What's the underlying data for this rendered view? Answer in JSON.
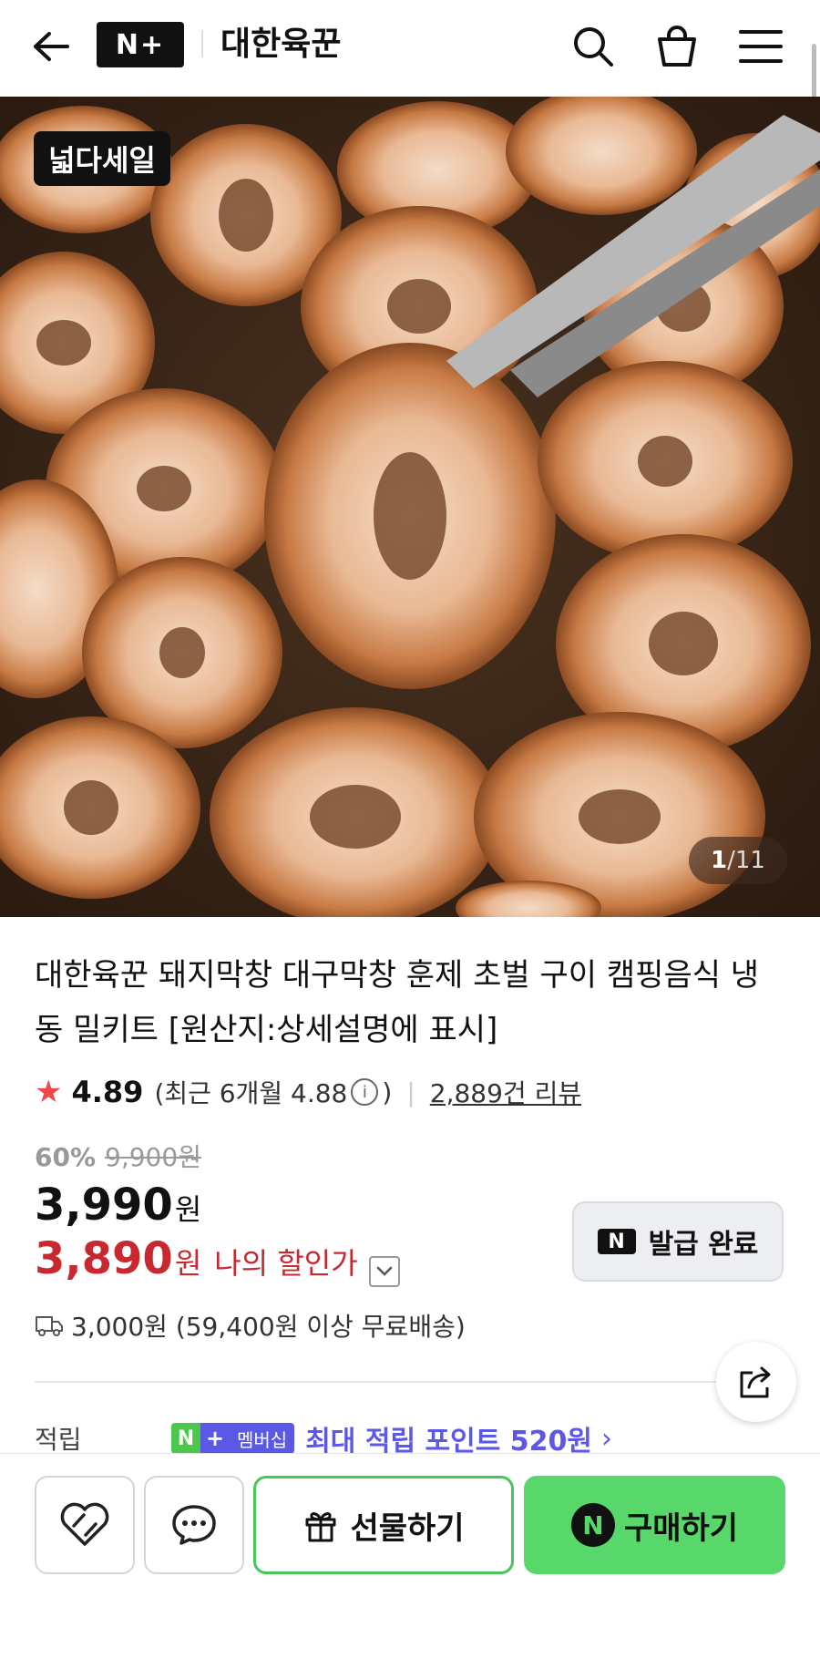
{
  "header": {
    "logo_text": "N+",
    "store_name": "대한육꾼"
  },
  "hero": {
    "sale_badge": "넓다세일",
    "counter_current": "1",
    "counter_total": "/11"
  },
  "product": {
    "title": "대한육꾼 돼지막창 대구막창 훈제 초벌 구이 캠핑음식 냉동 밀키트 [원산지:상세설명에 표시]",
    "rating": "4.89",
    "recent_rating": "(최근 6개월 4.88",
    "recent_close": ")",
    "info_icon": "i",
    "review_count": "2,889건 리뷰",
    "discount_percent": "60%",
    "original_price": "9,900원",
    "price": "3,990",
    "price_unit": "원",
    "my_price": "3,890",
    "my_price_unit": "원",
    "my_price_label": "나의 할인가",
    "shipping": "3,000원 (59,400원 이상 무료배송)"
  },
  "coupon": {
    "logo": "N",
    "label": "발급 완료"
  },
  "points": {
    "label": "적립",
    "badge_n": "N",
    "badge_plus": "+",
    "badge_membership": "멤버십",
    "text": "최대 적립 포인트 520원"
  },
  "bottom_bar": {
    "gift_label": "선물하기",
    "buy_logo": "N",
    "buy_label": "구매하기"
  },
  "colors": {
    "accent_red": "#c8282f",
    "star_red": "#f04848",
    "naver_green": "#58d86a",
    "membership_purple": "#5b58e6"
  },
  "icons": [
    "back-arrow-icon",
    "search-icon",
    "shopping-bag-icon",
    "menu-icon",
    "star-icon",
    "info-icon",
    "chevron-down-icon",
    "truck-icon",
    "share-icon",
    "heart-icon",
    "chat-icon",
    "gift-icon"
  ]
}
